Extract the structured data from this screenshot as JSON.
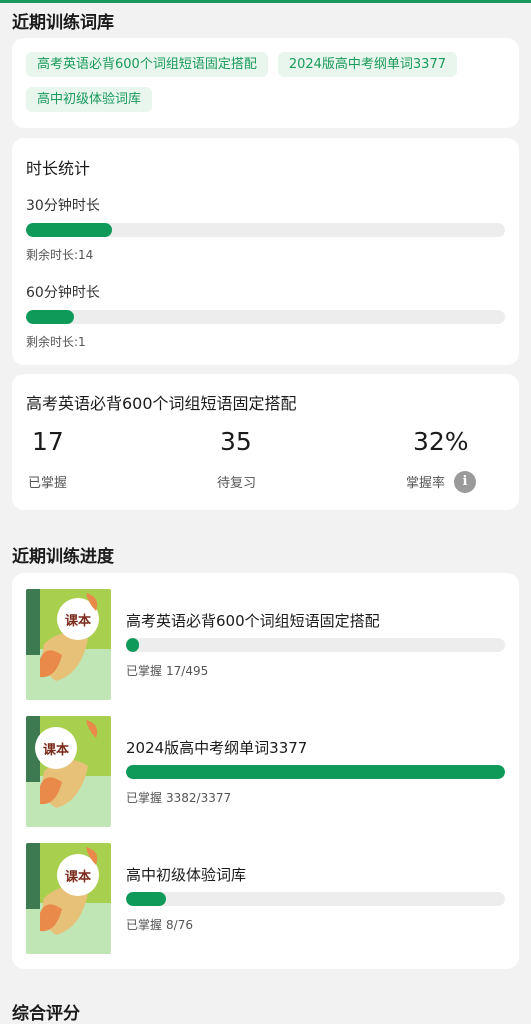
{
  "sections": {
    "recent_libraries": "近期训练词库",
    "recent_progress": "近期训练进度",
    "overall_score": "综合评分"
  },
  "library_tags": [
    "高考英语必背600个词组短语固定搭配",
    "2024版高中考纲单词3377",
    "高中初级体验词库"
  ],
  "duration": {
    "title": "时长统计",
    "rows": [
      {
        "label": "30分钟时长",
        "remaining": "剩余时长:14",
        "progress": 0.18
      },
      {
        "label": "60分钟时长",
        "remaining": "剩余时长:1",
        "progress": 0.1
      }
    ]
  },
  "mastery": {
    "title": "高考英语必背600个词组短语固定搭配",
    "stats": [
      {
        "value": "17",
        "label": "已掌握"
      },
      {
        "value": "35",
        "label": "待复习"
      },
      {
        "value": "32%",
        "label": "掌握率"
      }
    ],
    "info_icon": "i"
  },
  "progress_items": [
    {
      "title": "高考英语必背600个词组短语固定搭配",
      "mastered_label": "已掌握",
      "count": "17/495",
      "progress": 0.034,
      "book_label": "课本"
    },
    {
      "title": "2024版高中考纲单词3377",
      "mastered_label": "已掌握",
      "count": "3382/3377",
      "progress": 1.0,
      "book_label": "课本"
    },
    {
      "title": "高中初级体验词库",
      "mastered_label": "已掌握",
      "count": "8/76",
      "progress": 0.105,
      "book_label": "课本"
    }
  ],
  "colors": {
    "accent": "#0f9a5a",
    "tag_bg": "#e8f6ee",
    "track": "#ededed"
  }
}
